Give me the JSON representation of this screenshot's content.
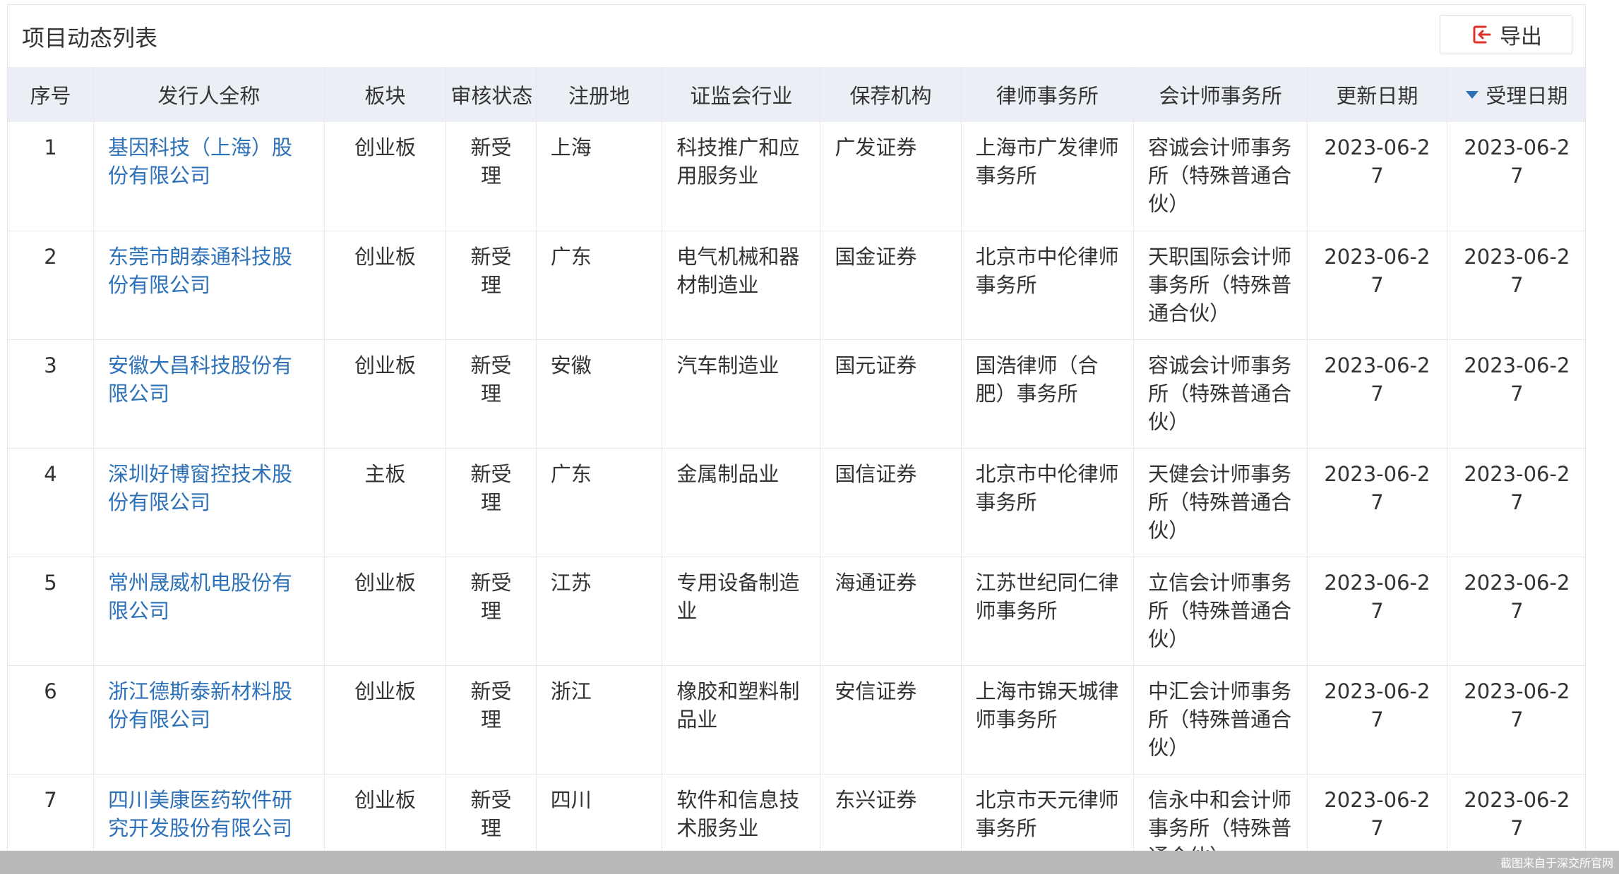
{
  "panel": {
    "title": "项目动态列表",
    "export_label": "导出"
  },
  "columns": [
    "序号",
    "发行人全称",
    "板块",
    "审核状态",
    "注册地",
    "证监会行业",
    "保荐机构",
    "律师事务所",
    "会计师事务所",
    "更新日期",
    "受理日期"
  ],
  "sort": {
    "column": "受理日期",
    "direction": "desc"
  },
  "rows": [
    {
      "no": "1",
      "issuer": "基因科技（上海）股份有限公司",
      "board": "创业板",
      "status": "新受理",
      "region": "上海",
      "industry": "科技推广和应用服务业",
      "sponsor": "广发证券",
      "law_firm": "上海市广发律师事务所",
      "accounting_firm": "容诚会计师事务所（特殊普通合伙）",
      "updated": "2023-06-27",
      "accepted": "2023-06-27"
    },
    {
      "no": "2",
      "issuer": "东莞市朗泰通科技股份有限公司",
      "board": "创业板",
      "status": "新受理",
      "region": "广东",
      "industry": "电气机械和器材制造业",
      "sponsor": "国金证券",
      "law_firm": "北京市中伦律师事务所",
      "accounting_firm": "天职国际会计师事务所（特殊普通合伙）",
      "updated": "2023-06-27",
      "accepted": "2023-06-27"
    },
    {
      "no": "3",
      "issuer": "安徽大昌科技股份有限公司",
      "board": "创业板",
      "status": "新受理",
      "region": "安徽",
      "industry": "汽车制造业",
      "sponsor": "国元证券",
      "law_firm": "国浩律师（合肥）事务所",
      "accounting_firm": "容诚会计师事务所（特殊普通合伙）",
      "updated": "2023-06-27",
      "accepted": "2023-06-27"
    },
    {
      "no": "4",
      "issuer": "深圳好博窗控技术股份有限公司",
      "board": "主板",
      "status": "新受理",
      "region": "广东",
      "industry": "金属制品业",
      "sponsor": "国信证券",
      "law_firm": "北京市中伦律师事务所",
      "accounting_firm": "天健会计师事务所（特殊普通合伙）",
      "updated": "2023-06-27",
      "accepted": "2023-06-27"
    },
    {
      "no": "5",
      "issuer": "常州晟威机电股份有限公司",
      "board": "创业板",
      "status": "新受理",
      "region": "江苏",
      "industry": "专用设备制造业",
      "sponsor": "海通证券",
      "law_firm": "江苏世纪同仁律师事务所",
      "accounting_firm": "立信会计师事务所（特殊普通合伙）",
      "updated": "2023-06-27",
      "accepted": "2023-06-27"
    },
    {
      "no": "6",
      "issuer": "浙江德斯泰新材料股份有限公司",
      "board": "创业板",
      "status": "新受理",
      "region": "浙江",
      "industry": "橡胶和塑料制品业",
      "sponsor": "安信证券",
      "law_firm": "上海市锦天城律师事务所",
      "accounting_firm": "中汇会计师事务所（特殊普通合伙）",
      "updated": "2023-06-27",
      "accepted": "2023-06-27"
    },
    {
      "no": "7",
      "issuer": "四川美康医药软件研究开发股份有限公司",
      "board": "创业板",
      "status": "新受理",
      "region": "四川",
      "industry": "软件和信息技术服务业",
      "sponsor": "东兴证券",
      "law_firm": "北京市天元律师事务所",
      "accounting_firm": "信永中和会计师事务所（特殊普通合伙）",
      "updated": "2023-06-27",
      "accepted": "2023-06-27"
    }
  ],
  "footer_note": "截图来自于深交所官网",
  "colors": {
    "link": "#2d71b8",
    "header_bg": "#ebeff5",
    "footer_bar": "#b9b9b9"
  }
}
